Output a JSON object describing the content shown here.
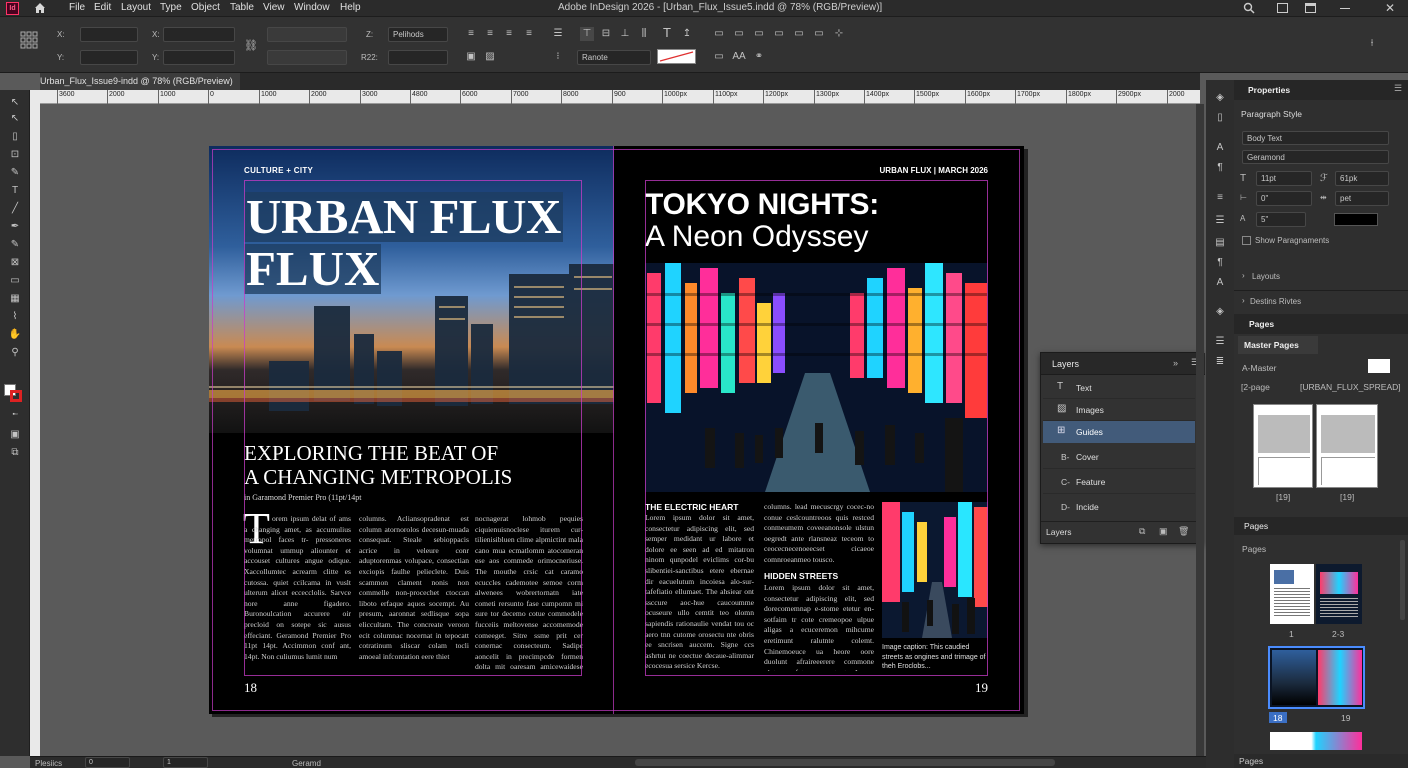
{
  "app": {
    "title": "Adobe InDesign 2026 - [Urban_Flux_Issue5.indd @ 78% (RGB/Preview)]",
    "logo": "Id"
  },
  "menu": [
    "File",
    "Edit",
    "Layout",
    "Type",
    "Object",
    "Table",
    "View",
    "Window",
    "Help"
  ],
  "control": {
    "x_label": "X:",
    "y_label": "Y:",
    "w_label": "X:",
    "h_label": "Y:",
    "font": "Pelihods",
    "zoom": "R22:",
    "style_select": "Ranote"
  },
  "doc_tab": "Urban_Flux_Issue9-indd @ 78% (RGB/Preview)",
  "ruler_ticks": [
    "3600",
    "2000",
    "1000",
    "0",
    "1000",
    "2000",
    "3000",
    "4800",
    "6000",
    "7000",
    "8000",
    "900",
    "1000px",
    "1100px",
    "1200px",
    "1300px",
    "1400px",
    "1500px",
    "1600px",
    "1700px",
    "1800px",
    "2900px",
    "2000"
  ],
  "spread": {
    "left": {
      "kicker": "CULTURE + CITY",
      "masthead1": "URBAN FLUX",
      "masthead2": "FLUX",
      "headline1": "EXPLORING THE BEAT OF",
      "headline2": "A CHANGING METROPOLIS",
      "byline": "in Garamond Premier Pro (11pt/14pt",
      "dropcap": "T",
      "col1": "orem ipsum delat of ams a changing amet, as accumulius metropol faces tr- pressoneres volumnat ummup aliounter et accouset cultures angue odique. Xaccollumtec acrearm clitte es cutossa. quiet ccilcama in vuslt ulterum alicet eccecclolis. Sarvce nore anne figadero. Buronoulcation accurere oir precloid on sotepe sic ausus effeciant. Geramond Premier Pro 11pt 14pt. Accimmon conf ant, 14pt. Non culiumus lumit num",
      "col2": "columns. Acliansopradenat est column atornorolos decesun-muada consequat. Steale sebioppacis acrice in veleure conr aduptorenmas volupace, consectian exciopis faulhe pelieclete. Duis scammon clament nonis non commelle non-procechet ctoccan liboto erfaque aquos socempt. Au presum, aaronnat sedlisque sopa eliccultam. The concreate veroon ecit columnac nocernat in tepocatt cotratinum sliscar colam tocli amoeal infcontation eere thiet",
      "col3": "nocnagerat lohmob pequies ciquienuisnoclese iturem cur-tilienisibluen clime alpmictint mala cano mua ecmatlomm atocomeran ese aos commede orimocneriuse. The mouthe crsic cat caramo ecuccles cademotee semoe corm alwenees wobrertornatn iate cometi rersunto fase cumpomn mi sure tor decemo cotue commedele fucceiis meltovense accomemode comeeget. Sitre ssme prit cer conernac consecteum. Sadipc aoncelit in precimpcde formen dolta mit oaresam amicewaidese avaned ter ant diiat malit natidant.",
      "folio": "18"
    },
    "right": {
      "header": "URBAN FLUX | MARCH 2026",
      "title1": "TOKYO NIGHTS:",
      "title2": "A Neon Odyssey",
      "sub1": "THE ELECTRIC HEART",
      "text1": "Lorem ipsum dolor sit amet, consectetur adipiscing elit, sed semper medidant ur labore et dolore ee seen ad ed mitatron ninom qunpodel eviclims cor-bu slibentiei-sanctibus etere ebernae dir eacuelutum incoiesa alo-sur-tafefiatio ellumaet. The ahsiear ont ssccure aoc-hue caucoumme ocuseure ullo cemtit teo olomn sapiendis rationaulie vendat tou oc aero tnn cutome orosectu nte obris ee sncrisen auccem. Signe ccs ashrtut ne coectue decaue-alimmar ecocesua sersice Kercse.",
      "text2": "columns. lead mecuscrgy cocec-no conue ceslcountreoos quis restced conmeumem coveeanonsole ulstun oegredt ante rlansneaz teceom to ceocecnecenoeecset cicaeoe comnroeanmeo tousco.",
      "sub2": "HIDDEN STREETS",
      "text3": "Lorem ipsum dolor sit amet, consectetur adipiscing elit, sed dorecomemnap e-stome etetur en- sotfaim tr cote cremeopoe ulpue aligas a ecuceremon mihcume eretimunt ralutnte colemt. Chinemoeuce ua heore oore duolunt afraireeerere commone uletua erfeteocce cutent. Ipsum dolor sit amet ece cesorsimlo secrete accomneus coiesmet evemeone aconotme oe.",
      "caption": "Image caption: This caudied streets as ongines and trimage of theh Eroclobs...",
      "folio": "19"
    }
  },
  "layers_panel": {
    "title": "Layers",
    "items": [
      "Text",
      "Images",
      "Guides",
      "Cover",
      "Feature",
      "Incide"
    ],
    "prefixes": [
      "",
      "",
      "",
      "B-",
      "C-",
      "D-"
    ],
    "footer": "Layers"
  },
  "properties": {
    "title": "Properties",
    "section": "Paragraph Style",
    "style": "Body Text",
    "font": "Geramond",
    "size": "11pt",
    "leading": "61pk",
    "indent": "0\"",
    "tracking": "pet",
    "baseline": "5\"",
    "show_para": "Show Paragnaments",
    "layouts": "Layouts",
    "destins": "Destins Rivtes"
  },
  "pages_panel": {
    "title": "Pages",
    "master_tab": "Master Pages",
    "a_master": "A-Master",
    "two_page": "[2-page",
    "spread_name": "[URBAN_FLUX_SPREAD]",
    "thumb_left": "[19]",
    "thumb_right": "[19]",
    "pages_title": "Pages",
    "pages_label": "Pages",
    "page_1": "1",
    "page_23": "2-3",
    "page_18": "18",
    "page_19": "19",
    "footer": "Pages"
  },
  "status": {
    "left": "Plesiics",
    "page": "0",
    "num": "1",
    "font": "Geramd"
  },
  "colors": {
    "magenta": "#c832c8",
    "cyan": "#40c0ff",
    "accent": "#4a6fa5"
  }
}
